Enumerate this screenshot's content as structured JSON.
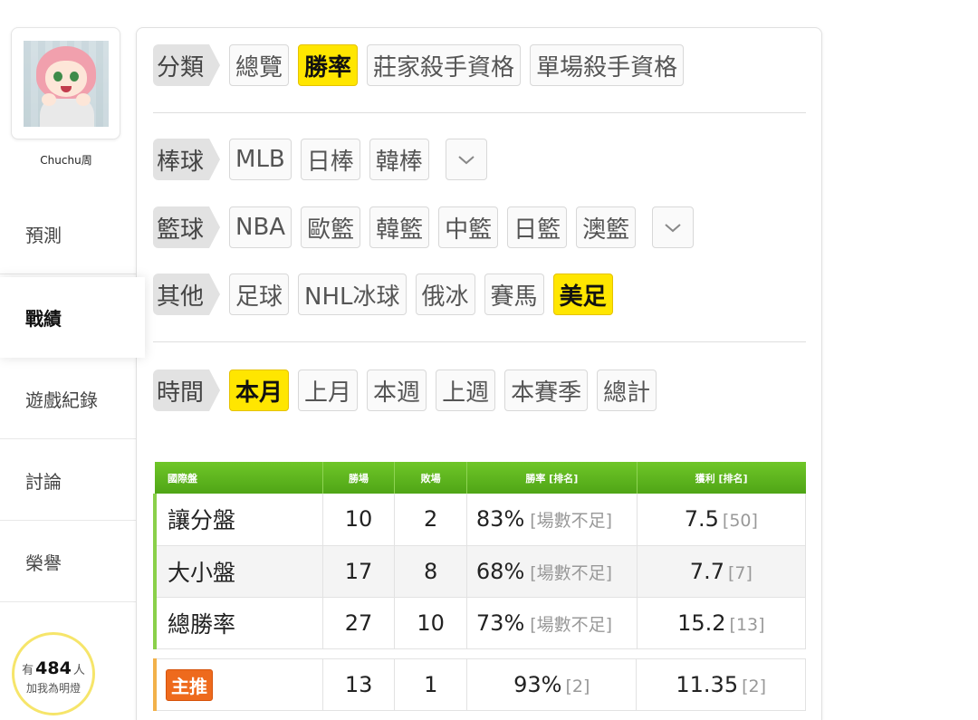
{
  "user": {
    "name": "Chuchu周"
  },
  "sidebar": {
    "items": [
      {
        "label": "預測",
        "active": false
      },
      {
        "label": "戰績",
        "active": true
      },
      {
        "label": "遊戲紀錄",
        "active": false
      },
      {
        "label": "討論",
        "active": false
      },
      {
        "label": "榮譽",
        "active": false
      }
    ],
    "fans": {
      "prefix": "有",
      "count": "484",
      "suffix": "人",
      "line2": "加我為明燈"
    }
  },
  "filters": {
    "category": {
      "tag": "分類",
      "options": [
        "總覽",
        "勝率",
        "莊家殺手資格",
        "單場殺手資格"
      ],
      "selected": "勝率"
    },
    "baseball": {
      "tag": "棒球",
      "options": [
        "MLB",
        "日棒",
        "韓棒"
      ]
    },
    "basketball": {
      "tag": "籃球",
      "options": [
        "NBA",
        "歐籃",
        "韓籃",
        "中籃",
        "日籃",
        "澳籃"
      ]
    },
    "other": {
      "tag": "其他",
      "options": [
        "足球",
        "NHL冰球",
        "俄冰",
        "賽馬",
        "美足"
      ],
      "selected": "美足"
    },
    "time": {
      "tag": "時間",
      "options": [
        "本月",
        "上月",
        "本週",
        "上週",
        "本賽季",
        "總計"
      ],
      "selected": "本月"
    }
  },
  "table": {
    "headers": [
      "國際盤",
      "勝場",
      "敗場",
      "勝率 [排名]",
      "獲利 [排名]"
    ],
    "rows": [
      {
        "name": "讓分盤",
        "win": "10",
        "loss": "2",
        "rate": "83%",
        "rate_note": "[場數不足]",
        "profit": "7.5",
        "profit_rank": "[50]"
      },
      {
        "name": "大小盤",
        "win": "17",
        "loss": "8",
        "rate": "68%",
        "rate_note": "[場數不足]",
        "profit": "7.7",
        "profit_rank": "[7]"
      },
      {
        "name": "總勝率",
        "win": "27",
        "loss": "10",
        "rate": "73%",
        "rate_note": "[場數不足]",
        "profit": "15.2",
        "profit_rank": "[13]"
      }
    ],
    "main_pick": {
      "badge": "主推",
      "win": "13",
      "loss": "1",
      "rate": "93%",
      "rate_rank": "[2]",
      "profit": "11.35",
      "profit_rank": "[2]"
    }
  },
  "colors": {
    "selected": "#ffe600",
    "header_green": "#5cb31d",
    "badge_orange": "#ee6a1d"
  }
}
